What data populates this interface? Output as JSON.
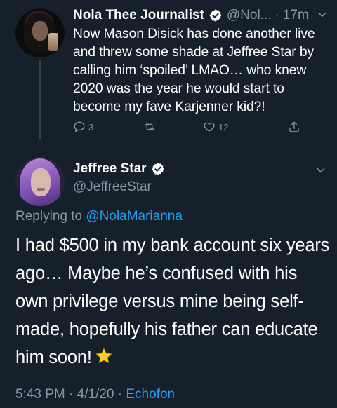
{
  "reply_tweet": {
    "author_name": "Nola Thee Journalist",
    "handle": "@Nol...",
    "separator": "·",
    "time_ago": "17m",
    "text": "Now Mason Disick has done another live and threw some shade at Jeffree Star by calling him ‘spoiled’ LMAO… who knew 2020 was the year he would start to become my fave Karjenner kid?!",
    "actions": {
      "reply_count": "3",
      "retweet_count": "",
      "like_count": "12"
    }
  },
  "main_tweet": {
    "author_name": "Jeffree Star",
    "handle": "@JeffreeStar",
    "replying_prefix": "Replying to",
    "replying_to": "@NolaMarianna",
    "text": "I had $500 in my bank account six years ago… Maybe he’s confused with his own privilege versus mine being self-made, hopefully his father can educate him soon!",
    "timestamp": "5:43 PM · 4/1/20 · ",
    "source": "Echofon"
  },
  "colors": {
    "background": "#15202b",
    "text": "#ffffff",
    "muted": "#8899a6",
    "accent": "#1da1f2",
    "divider": "#38444d",
    "star": "#ffcc33"
  },
  "icons": [
    "verified-badge-icon",
    "chevron-down-icon",
    "reply-icon",
    "retweet-icon",
    "like-icon",
    "share-icon",
    "star-emoji-icon"
  ]
}
